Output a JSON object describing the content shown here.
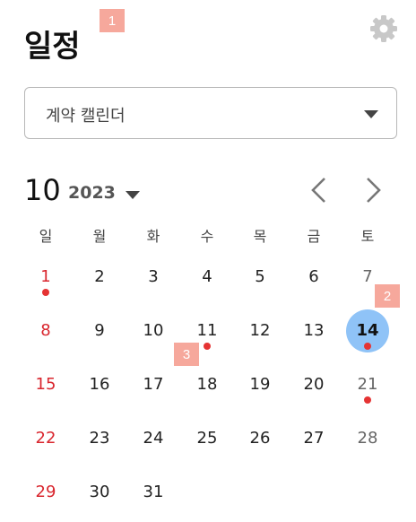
{
  "header": {
    "title": "일정",
    "settings_icon": "gear-icon"
  },
  "markers": [
    "1",
    "2",
    "3"
  ],
  "calendar_select": {
    "value": "계약 캘린더"
  },
  "calendar": {
    "month": "10",
    "year": "2023",
    "weekdays": [
      "일",
      "월",
      "화",
      "수",
      "목",
      "금",
      "토"
    ],
    "selected_day": 14,
    "event_days": [
      1,
      11,
      14,
      21
    ],
    "weeks": [
      [
        "1",
        "2",
        "3",
        "4",
        "5",
        "6",
        "7"
      ],
      [
        "8",
        "9",
        "10",
        "11",
        "12",
        "13",
        "14"
      ],
      [
        "15",
        "16",
        "17",
        "18",
        "19",
        "20",
        "21"
      ],
      [
        "22",
        "23",
        "24",
        "25",
        "26",
        "27",
        "28"
      ],
      [
        "29",
        "30",
        "31"
      ]
    ]
  },
  "colors": {
    "sunday": "#d9262e",
    "selected_bg": "#8fc3f7",
    "event_dot": "#e53333",
    "marker_bg": "#f6a89c"
  }
}
